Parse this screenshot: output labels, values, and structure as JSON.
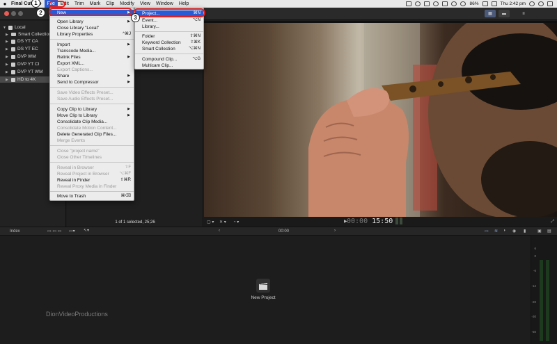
{
  "menubar": {
    "app_name": "Final Cut Pro",
    "items": [
      "File",
      "Edit",
      "Trim",
      "Mark",
      "Clip",
      "Modify",
      "View",
      "Window",
      "Help"
    ],
    "battery": "86%",
    "clock": "Thu 2:42 pm"
  },
  "sidebar": {
    "local_label": "Local",
    "items": [
      "Smart Collections",
      "DS YT CA",
      "DS YT EC",
      "DVP WM",
      "DVP YT CI",
      "DVP YT WM",
      "HD to 4K"
    ]
  },
  "browser": {
    "status": "1 of 1 selected, 25;26"
  },
  "viewer": {
    "timecode_dim": "00:00",
    "timecode_bright": "15:50"
  },
  "timeline": {
    "index_label": "Index",
    "timecode_small": "00:00",
    "new_project_label": "New Project",
    "watermark": "DionVideoProductions",
    "meter_ticks": [
      "6",
      "0",
      "-6",
      "-12",
      "-20",
      "-30",
      "-50"
    ]
  },
  "file_menu": {
    "items": [
      {
        "label": "New",
        "shortcut": "",
        "sub": true,
        "disabled": false,
        "highlight": true
      },
      {
        "label": "Open Library",
        "shortcut": "",
        "sub": true,
        "disabled": false
      },
      {
        "label": "Close Library \"Local\"",
        "shortcut": "",
        "sub": false,
        "disabled": false
      },
      {
        "label": "Library Properties",
        "shortcut": "^⌘J",
        "sub": false,
        "disabled": false
      },
      {
        "label": "Import",
        "shortcut": "",
        "sub": true,
        "disabled": false
      },
      {
        "label": "Transcode Media...",
        "shortcut": "",
        "sub": false,
        "disabled": false
      },
      {
        "label": "Relink Files",
        "shortcut": "",
        "sub": true,
        "disabled": false
      },
      {
        "label": "Export XML...",
        "shortcut": "",
        "sub": false,
        "disabled": false
      },
      {
        "label": "Export Captions...",
        "shortcut": "",
        "sub": false,
        "disabled": true
      },
      {
        "label": "Share",
        "shortcut": "",
        "sub": true,
        "disabled": false
      },
      {
        "label": "Send to Compressor",
        "shortcut": "",
        "sub": true,
        "disabled": false
      },
      {
        "label": "Save Video Effects Preset...",
        "shortcut": "",
        "sub": false,
        "disabled": true
      },
      {
        "label": "Save Audio Effects Preset...",
        "shortcut": "",
        "sub": false,
        "disabled": true
      },
      {
        "label": "Copy Clip to Library",
        "shortcut": "",
        "sub": true,
        "disabled": false
      },
      {
        "label": "Move Clip to Library",
        "shortcut": "",
        "sub": true,
        "disabled": false
      },
      {
        "label": "Consolidate Clip Media...",
        "shortcut": "",
        "sub": false,
        "disabled": false
      },
      {
        "label": "Consolidate Motion Content...",
        "shortcut": "",
        "sub": false,
        "disabled": true
      },
      {
        "label": "Delete Generated Clip Files...",
        "shortcut": "",
        "sub": false,
        "disabled": false
      },
      {
        "label": "Merge Events",
        "shortcut": "",
        "sub": false,
        "disabled": true
      },
      {
        "label": "Close \"project name\"",
        "shortcut": "",
        "sub": false,
        "disabled": true
      },
      {
        "label": "Close Other Timelines",
        "shortcut": "",
        "sub": false,
        "disabled": true
      },
      {
        "label": "Reveal in Browser",
        "shortcut": "⇧F",
        "sub": false,
        "disabled": true
      },
      {
        "label": "Reveal Project in Browser",
        "shortcut": "⌥⌘F",
        "sub": false,
        "disabled": true
      },
      {
        "label": "Reveal in Finder",
        "shortcut": "⇧⌘R",
        "sub": false,
        "disabled": false
      },
      {
        "label": "Reveal Proxy Media in Finder",
        "shortcut": "",
        "sub": false,
        "disabled": true
      },
      {
        "label": "Move to Trash",
        "shortcut": "⌘⌫",
        "sub": false,
        "disabled": false
      }
    ]
  },
  "new_menu": {
    "items": [
      {
        "label": "Project...",
        "shortcut": "⌘N",
        "disabled": false,
        "highlight": true
      },
      {
        "label": "Event...",
        "shortcut": "⌥N",
        "disabled": false
      },
      {
        "label": "Library...",
        "shortcut": "",
        "disabled": false
      },
      {
        "label": "Folder",
        "shortcut": "⇧⌘N",
        "disabled": false
      },
      {
        "label": "Keyword Collection",
        "shortcut": "⇧⌘K",
        "disabled": false
      },
      {
        "label": "Smart Collection",
        "shortcut": "⌥⌘N",
        "disabled": false
      },
      {
        "label": "Compound Clip...",
        "shortcut": "⌥G",
        "disabled": false
      },
      {
        "label": "Multicam Clip...",
        "shortcut": "",
        "disabled": false
      }
    ]
  },
  "callouts": [
    "1",
    "2",
    "3"
  ]
}
